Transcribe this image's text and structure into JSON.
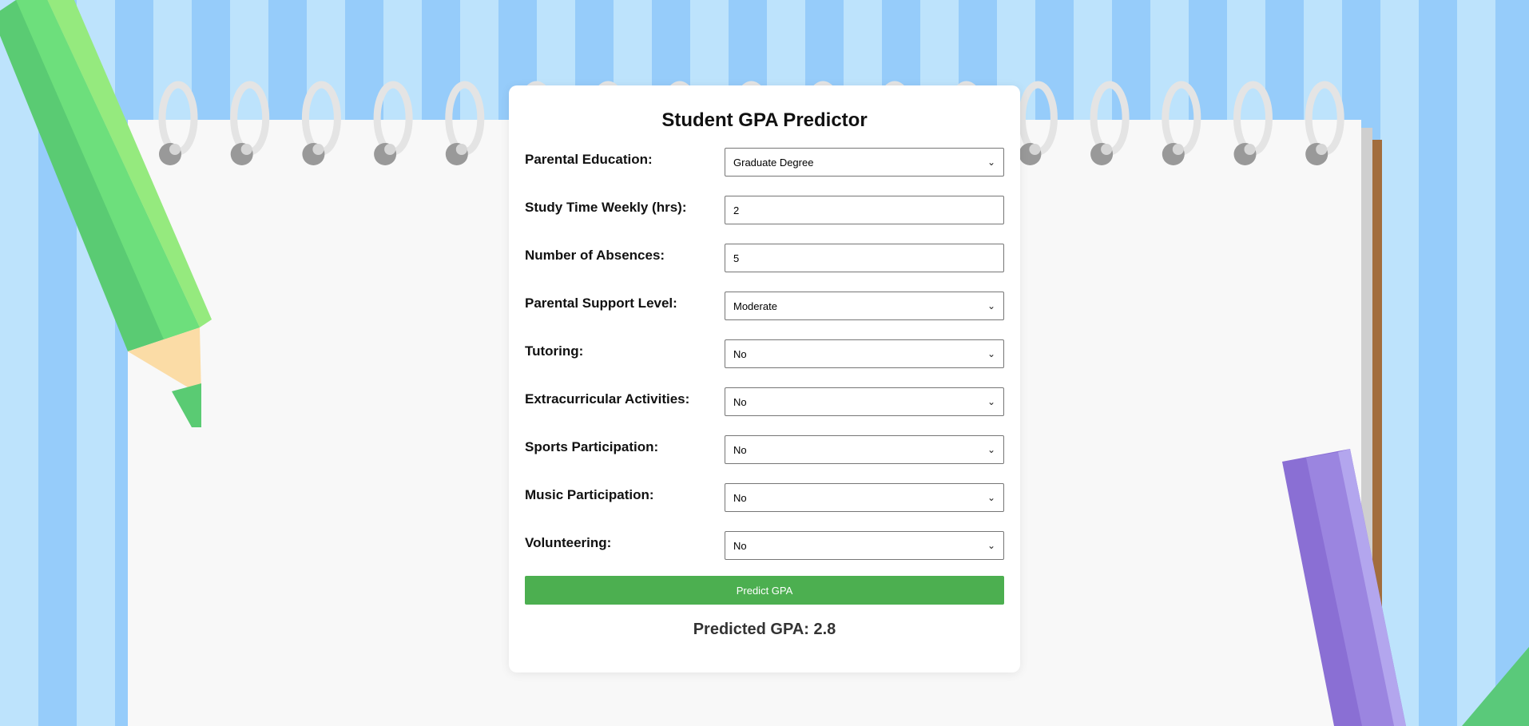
{
  "title": "Student GPA Predictor",
  "form": {
    "fields": [
      {
        "label": "Parental Education:",
        "value": "Graduate Degree"
      },
      {
        "label": "Study Time Weekly (hrs):",
        "value": "2"
      },
      {
        "label": "Number of Absences:",
        "value": "5"
      },
      {
        "label": "Parental Support Level:",
        "value": "Moderate"
      },
      {
        "label": "Tutoring:",
        "value": "No"
      },
      {
        "label": "Extracurricular Activities:",
        "value": "No"
      },
      {
        "label": "Sports Participation:",
        "value": "No"
      },
      {
        "label": "Music Participation:",
        "value": "No"
      },
      {
        "label": "Volunteering:",
        "value": "No"
      }
    ],
    "submit_label": "Predict GPA"
  },
  "result": {
    "text": "Predicted GPA: 2.8"
  },
  "colors": {
    "button": "#4caf50",
    "stripe_light": "#bde3fc",
    "stripe_dark": "#96ccfa",
    "green_pencil": "#6ddf7c",
    "purple_pencil": "#9b85e0"
  },
  "icons": {
    "dropdown": "chevron-down-icon"
  }
}
